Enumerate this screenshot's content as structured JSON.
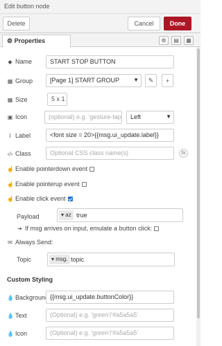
{
  "title": "Edit button node",
  "actions": {
    "delete": "Delete",
    "cancel": "Cancel",
    "done": "Done"
  },
  "tabs": {
    "properties": "Properties"
  },
  "form": {
    "name": {
      "label": "Name",
      "value": "START STOP BUTTON"
    },
    "group": {
      "label": "Group",
      "value": "[Page 1] START GROUP"
    },
    "size": {
      "label": "Size",
      "value": "5 x 1"
    },
    "icon": {
      "label": "Icon",
      "placeholder": "(optional) e.g. 'gesture-tap'",
      "position": "Left"
    },
    "label": {
      "label": "Label",
      "value": "<font size = 20>{{msg.ui_update.label}}"
    },
    "class": {
      "label": "Class",
      "placeholder": "Optional CSS class name(s)"
    },
    "pointerdown": {
      "label": "Enable pointerdown event"
    },
    "pointerup": {
      "label": "Enable pointerup event"
    },
    "click": {
      "label": "Enable click event"
    },
    "payload": {
      "label": "Payload",
      "type_prefix": "az",
      "value": "true"
    },
    "emulate": {
      "label": "If msg arrives on input, emulate a button click:"
    },
    "always_send": {
      "label": "Always Send:"
    },
    "topic": {
      "label": "Topic",
      "type_prefix": "msg.",
      "value": "topic"
    }
  },
  "custom_styling": {
    "title": "Custom Styling",
    "background": {
      "label": "Background",
      "value": "{{msg.ui_update.buttonColor}}"
    },
    "text": {
      "label": "Text",
      "placeholder": "(Optional) e.g. 'green'/'#a5a5a5'"
    },
    "icon": {
      "label": "Icon",
      "placeholder": "(Optional) e.g. 'green'/'#a5a5a5'"
    }
  },
  "colors": {
    "done": "#ad1625",
    "checkbox_on": "#1e73d8"
  }
}
